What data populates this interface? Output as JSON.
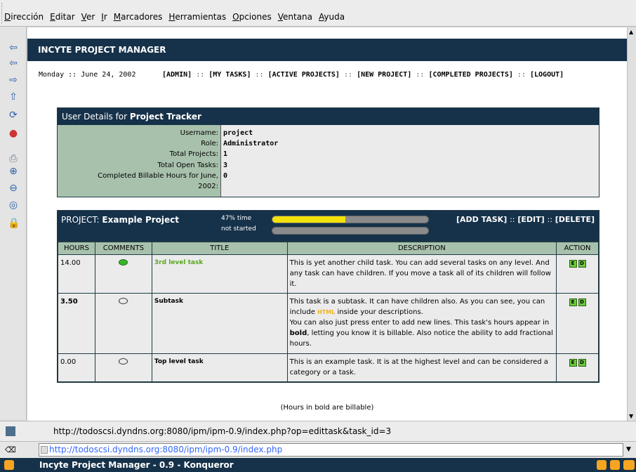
{
  "menu": [
    {
      "label": "Dirección",
      "key": "D",
      "rest": "irección"
    },
    {
      "label": "Editar",
      "key": "E",
      "rest": "ditar"
    },
    {
      "label": "Ver",
      "key": "V",
      "rest": "er"
    },
    {
      "label": "Ir",
      "key": "I",
      "rest": "r"
    },
    {
      "label": "Marcadores",
      "key": "M",
      "rest": "arcadores"
    },
    {
      "label": "Herramientas",
      "key": "H",
      "rest": "erramientas"
    },
    {
      "label": "Opciones",
      "key": "O",
      "rest": "pciones"
    },
    {
      "label": "Ventana",
      "key": "V",
      "rest": "entana"
    },
    {
      "label": "Ayuda",
      "key": "A",
      "rest": "yuda"
    }
  ],
  "app_title": "INCYTE PROJECT MANAGER",
  "nav": {
    "date": "Monday :: June 24, 2002",
    "links": [
      "[ADMIN]",
      "[MY TASKS]",
      "[ACTIVE PROJECTS]",
      "[NEW PROJECT]",
      "[COMPLETED PROJECTS]",
      "[LOGOUT]"
    ],
    "separator": "::"
  },
  "user_details": {
    "heading_prefix": "User Details for",
    "heading_name": "Project Tracker",
    "labels": [
      "Username:",
      "Role:",
      "Total Projects:",
      "Total Open Tasks:",
      "Completed Billable Hours for June,",
      "2002:"
    ],
    "values": [
      "project",
      "Administrator",
      "1",
      "3",
      "0",
      ""
    ]
  },
  "project": {
    "prefix": "PROJECT:",
    "name": "Example Project",
    "time_label": "47% time",
    "time_fraction": 0.47,
    "status_label": "not started",
    "status_fraction": 0,
    "actions": [
      "[ADD TASK]",
      "[EDIT]",
      "[DELETE]"
    ],
    "action_sep": "::"
  },
  "table": {
    "headers": [
      "HOURS",
      "COMMENTS",
      "TITLE",
      "DESCRIPTION",
      "ACTION"
    ],
    "rows": [
      {
        "hours": "14.00",
        "title": "3rd level task",
        "desc": "This is yet another child task. You can add several tasks on any level. And any task can have children. If you move a task all of its children will follow it."
      },
      {
        "hours": "3.50",
        "title": "Subtask",
        "desc_a": "This task is a subtask. It can have children also. As you can see, you can include",
        "desc_html": "HTML",
        "desc_b": "inside your descriptions.",
        "desc_c": "You can also just press enter to add new lines. This task's hours appear in",
        "desc_bold": "bold",
        "desc_d": ", letting you know it is billable. Also notice the ability to add fractional hours."
      },
      {
        "hours": "0.00",
        "title": "Top level task",
        "desc": "This is an example task. It is at the highest level and can be considered a category or a task."
      }
    ],
    "action_buttons": [
      "E",
      "D"
    ]
  },
  "footnote": "(Hours in bold are billable)",
  "status_url": "http://todoscsi.dyndns.org:8080/ipm/ipm-0.9/index.php?op=edittask&task_id=3",
  "location_url": "http://todoscsi.dyndns.org:8080/ipm/ipm-0.9/index.php",
  "window_title": "Incyte Project Manager - 0.9 - Konqueror",
  "colors": {
    "header": "#16324a",
    "label_bg": "#a8c1ad",
    "cell_bg": "#ebebeb",
    "progress_fill": "#f2e20a",
    "green_text": "#5aa81e",
    "html_highlight": "#f0b320"
  },
  "toolbar_icons": [
    "back-arrow-icon",
    "back-arrow-icon",
    "forward-arrow-icon",
    "up-arrow-icon",
    "reload-icon",
    "stop-icon",
    "print-icon",
    "zoom-in-icon",
    "zoom-out-icon",
    "find-icon",
    "lock-icon"
  ]
}
